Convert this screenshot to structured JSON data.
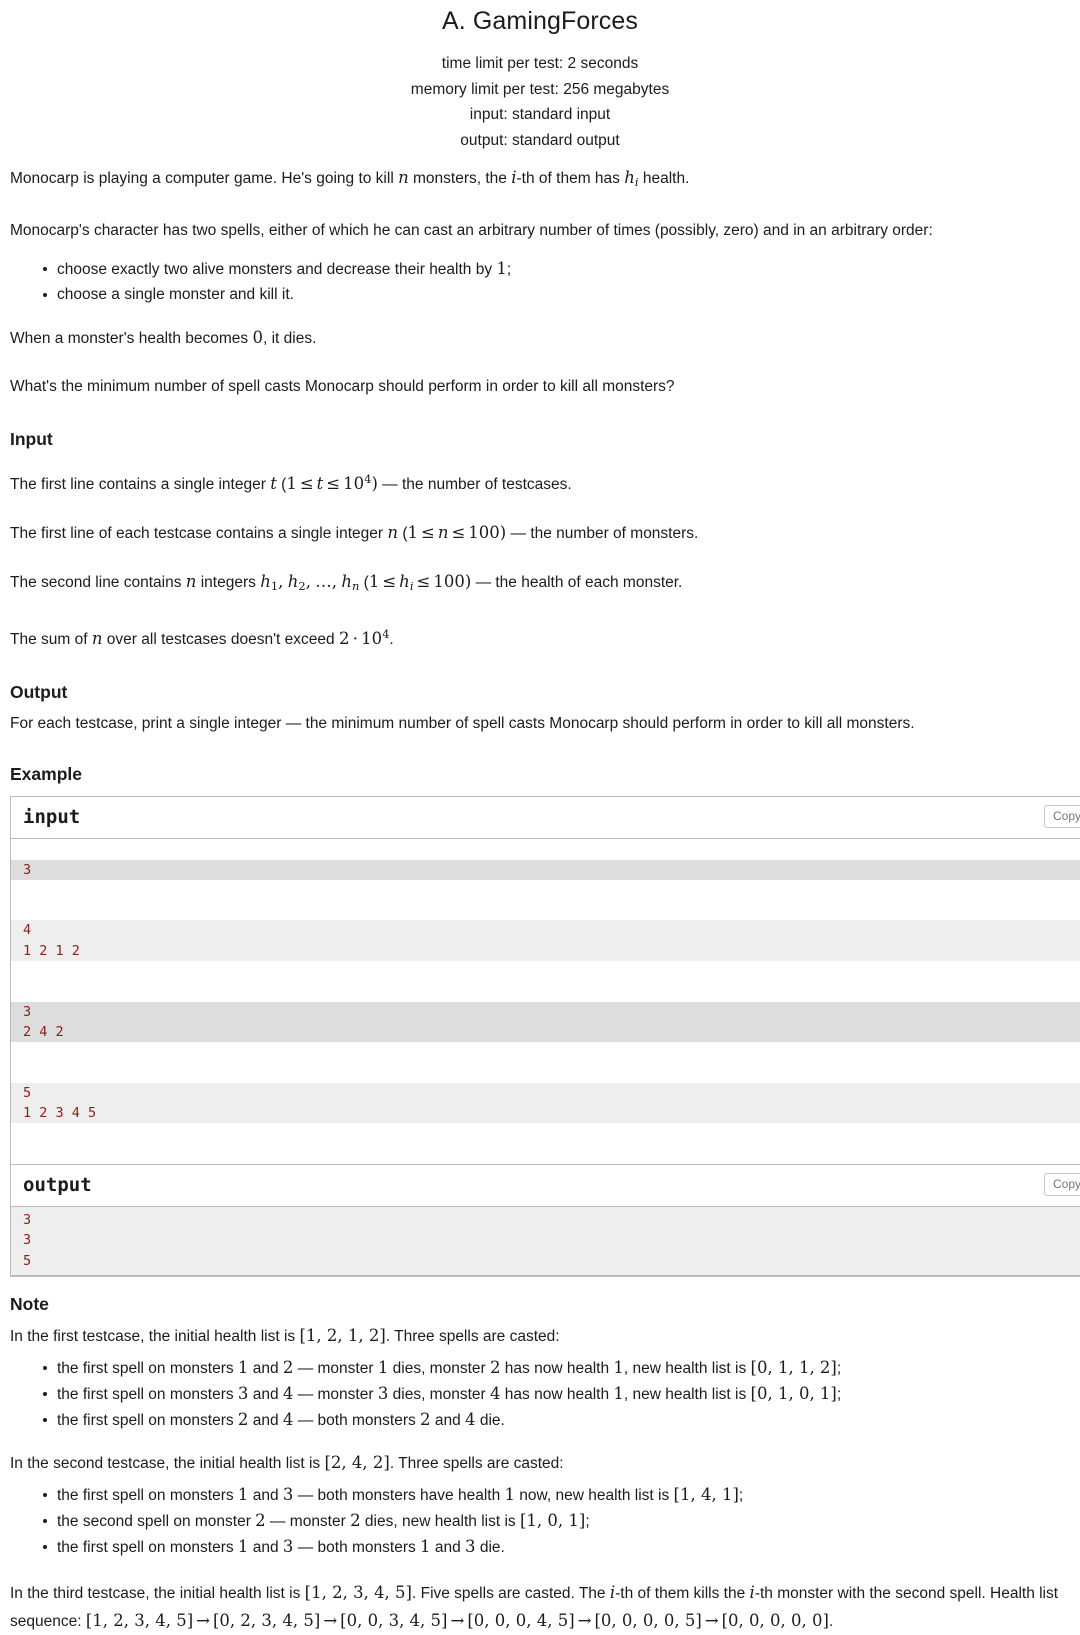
{
  "header": {
    "title": "A. GamingForces",
    "limits": [
      "time limit per test: 2 seconds",
      "memory limit per test: 256 megabytes",
      "input: standard input",
      "output: standard output"
    ]
  },
  "statement": {
    "p1_a": "Monocarp is playing a computer game. He's going to kill ",
    "p1_n": "n",
    "p1_b": " monsters, the ",
    "p1_i": "i",
    "p1_c": "-th of them has ",
    "p1_h": "h",
    "p1_hsub": "i",
    "p1_d": " health.",
    "p2": "Monocarp's character has two spells, either of which he can cast an arbitrary number of times (possibly, zero) and in an arbitrary order:",
    "spell1_a": "choose exactly two alive monsters and decrease their health by ",
    "spell1_v": "1",
    "spell1_b": ";",
    "spell2": "choose a single monster and kill it.",
    "p3_a": "When a monster's health becomes ",
    "p3_v": "0",
    "p3_b": ", it dies.",
    "p4": "What's the minimum number of spell casts Monocarp should perform in order to kill all monsters?"
  },
  "input_section": {
    "heading": "Input",
    "l1_a": "The first line contains a single integer ",
    "l1_t": "t",
    "l1_open": " (",
    "l1_one": "1",
    "l1_le1": "≤",
    "l1_t2": "t",
    "l1_le2": "≤",
    "l1_ten": "10",
    "l1_exp": "4",
    "l1_close": ")",
    "l1_b": " — the number of testcases.",
    "l2_a": "The first line of each testcase contains a single integer ",
    "l2_n": "n",
    "l2_open": " (",
    "l2_one": "1",
    "l2_le1": "≤",
    "l2_n2": "n",
    "l2_le2": "≤",
    "l2_hundred": "100",
    "l2_close": ")",
    "l2_b": " — the number of monsters.",
    "l3_a": "The second line contains ",
    "l3_n": "n",
    "l3_b": " integers ",
    "l3_h1": "h",
    "l3_h1s": "1",
    "l3_c1": ",",
    "l3_h2": "h",
    "l3_h2s": "2",
    "l3_c2": ",",
    "l3_dots": "…",
    "l3_c3": ",",
    "l3_hn": "h",
    "l3_hns": "n",
    "l3_open": " (",
    "l3_one": "1",
    "l3_le1": "≤",
    "l3_h": "h",
    "l3_hsub": "i",
    "l3_le2": "≤",
    "l3_hundred": "100",
    "l3_close": ")",
    "l3_d": " — the health of each monster.",
    "l4_a": "The sum of ",
    "l4_n": "n",
    "l4_b": " over all testcases doesn't exceed ",
    "l4_two": "2",
    "l4_dot": "⋅",
    "l4_ten": "10",
    "l4_exp": "4",
    "l4_c": "."
  },
  "output_section": {
    "heading": "Output",
    "text": "For each testcase, print a single integer — the minimum number of spell casts Monocarp should perform in order to kill all monsters."
  },
  "example": {
    "heading": "Example",
    "input_label": "input",
    "output_label": "output",
    "copy_label": "Copy",
    "input_groups": [
      [
        "3"
      ],
      [
        "4",
        "1 2 1 2"
      ],
      [
        "3",
        "2 4 2"
      ],
      [
        "5",
        "1 2 3 4 5"
      ]
    ],
    "output_lines": [
      "3",
      "3",
      "5"
    ]
  },
  "note": {
    "heading": "Note",
    "t1_a": "In the first testcase, the initial health list is ",
    "t1_list": "[1, 2, 1, 2]",
    "t1_b": ". Three spells are casted:",
    "t1_bullets": [
      {
        "a": "the first spell on monsters ",
        "m1": "1",
        "b": " and ",
        "m2": "2",
        "c": " — monster ",
        "m3": "1",
        "d": " dies, monster ",
        "m4": "2",
        "e": " has now health ",
        "m5": "1",
        "f": ", new health list is ",
        "list": "[0, 1, 1, 2]",
        "g": ";"
      },
      {
        "a": "the first spell on monsters ",
        "m1": "3",
        "b": " and ",
        "m2": "4",
        "c": " — monster ",
        "m3": "3",
        "d": " dies, monster ",
        "m4": "4",
        "e": " has now health ",
        "m5": "1",
        "f": ", new health list is ",
        "list": "[0, 1, 0, 1]",
        "g": ";"
      },
      {
        "a": "the first spell on monsters ",
        "m1": "2",
        "b": " and ",
        "m2": "4",
        "c": " — both monsters ",
        "m3": "2",
        "d": " and ",
        "m4": "4",
        "e": " die.",
        "m5": "",
        "f": "",
        "list": "",
        "g": ""
      }
    ],
    "t2_a": "In the second testcase, the initial health list is ",
    "t2_list": "[2, 4, 2]",
    "t2_b": ". Three spells are casted:",
    "t2_bullets": [
      {
        "a": "the first spell on monsters ",
        "m1": "1",
        "b": " and ",
        "m2": "3",
        "c": " — both monsters have health ",
        "m3": "1",
        "d": " now, new health list is ",
        "list": "[1, 4, 1]",
        "e": ";"
      },
      {
        "a": "the second spell on monster ",
        "m1": "2",
        "b": "",
        "m2": "",
        "c": " — monster ",
        "m3": "2",
        "d": " dies, new health list is ",
        "list": "[1, 0, 1]",
        "e": ";"
      },
      {
        "a": "the first spell on monsters ",
        "m1": "1",
        "b": " and ",
        "m2": "3",
        "c": " — both monsters ",
        "m3": "1",
        "d": " and ",
        "list": "3",
        "e": " die."
      }
    ],
    "t3_a": "In the third testcase, the initial health list is ",
    "t3_list": "[1, 2, 3, 4, 5]",
    "t3_b": ". Five spells are casted. The ",
    "t3_i1": "i",
    "t3_c": "-th of them kills the ",
    "t3_i2": "i",
    "t3_d": "-th monster with the second spell. Health list sequence: ",
    "t3_seq": [
      "[1, 2, 3, 4, 5]",
      "[0, 2, 3, 4, 5]",
      "[0, 0, 3, 4, 5]",
      "[0, 0, 0, 4, 5]",
      "[0, 0, 0, 0, 5]",
      "[0, 0, 0, 0, 0]"
    ],
    "t3_arrow": "→",
    "t3_end": "."
  }
}
